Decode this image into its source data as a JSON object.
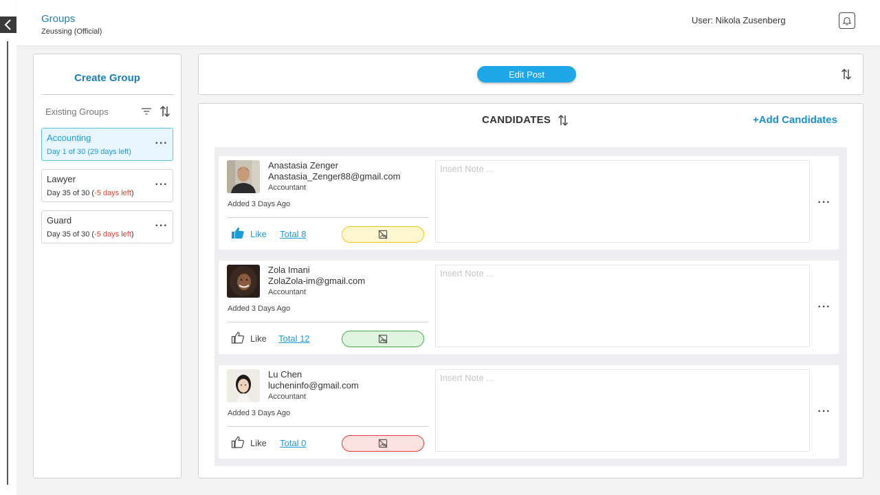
{
  "header": {
    "title": "Groups",
    "subtitle": "Zeussing (Official)",
    "user": "User: Nikola Zusenberg"
  },
  "sidebar": {
    "create_label": "Create Group",
    "existing_label": "Existing Groups",
    "groups": [
      {
        "name": "Accounting",
        "days": "Day 1 of 30 (29 days left)",
        "days_prefix": "",
        "days_left": "",
        "days_suffix": "",
        "active": true
      },
      {
        "name": "Lawyer",
        "days": "",
        "days_prefix": "Day 35 of 30 (",
        "days_left": "-5 days left",
        "days_suffix": ")",
        "active": false
      },
      {
        "name": "Guard",
        "days": "",
        "days_prefix": "Day 35 of 30 (",
        "days_left": "-5 days left",
        "days_suffix": ")",
        "active": false
      }
    ]
  },
  "top_panel": {
    "edit_post_label": "Edit Post"
  },
  "candidates": {
    "title": "CANDIDATES",
    "add_label": "+Add Candidates",
    "note_placeholder": "Insert Note ...",
    "like_label": "Like",
    "items": [
      {
        "name": "Anastasia Zenger",
        "email": "Anastasia_Zenger88@gmail.com",
        "role": "Accountant",
        "added": "Added  3 Days Ago",
        "total": "Total 8",
        "liked": true,
        "status_color": "#f5c518",
        "status_bg": "#fdf6cf"
      },
      {
        "name": "Zola Imani",
        "email": "ZolaZola-im@gmail.com",
        "role": "Accountant",
        "added": "Added  3 Days Ago",
        "total": "Total 12",
        "liked": false,
        "status_color": "#3cb043",
        "status_bg": "#dff5df"
      },
      {
        "name": "Lu Chen",
        "email": "lucheninfo@gmail.com",
        "role": "Accountant",
        "added": "Added  3 Days Ago",
        "total": "Total 0",
        "liked": false,
        "status_color": "#e03c31",
        "status_bg": "#fbe1df"
      }
    ]
  },
  "colors": {
    "accent": "#1a7fb5",
    "button": "#1ea6e6",
    "warning_text": "#e03c31"
  },
  "icons": [
    "back-chevron-icon",
    "bell-icon",
    "filter-icon",
    "sort-icon",
    "more-dots-icon",
    "thumbs-up-icon",
    "no-image-icon"
  ]
}
